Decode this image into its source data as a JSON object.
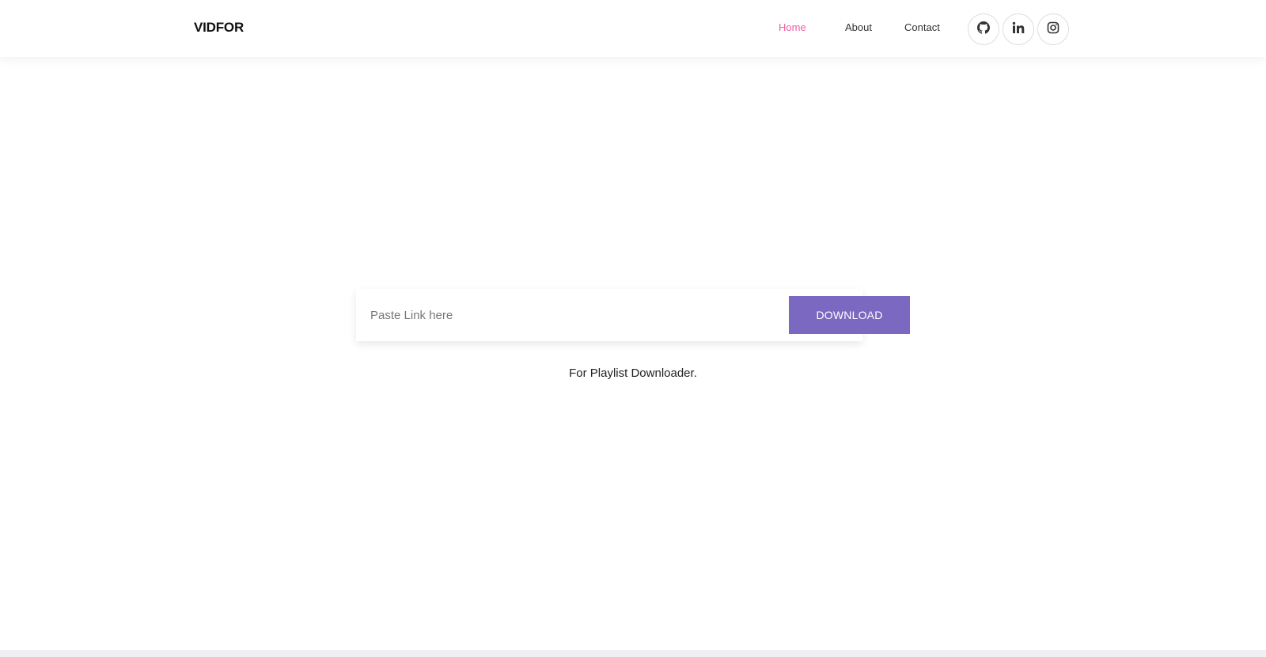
{
  "brand": "VIDFOR",
  "nav": {
    "home": "Home",
    "about": "About",
    "contact": "Contact",
    "active": "Home",
    "active_color": "#ec5fa3"
  },
  "social": {
    "icons": [
      "github-icon",
      "linkedin-icon",
      "instagram-icon"
    ]
  },
  "search": {
    "placeholder": "Paste Link here",
    "value": ""
  },
  "download_button": {
    "label": "DOWNLOAD",
    "color": "#7b68c0"
  },
  "playlist_link": "For Playlist Downloader."
}
